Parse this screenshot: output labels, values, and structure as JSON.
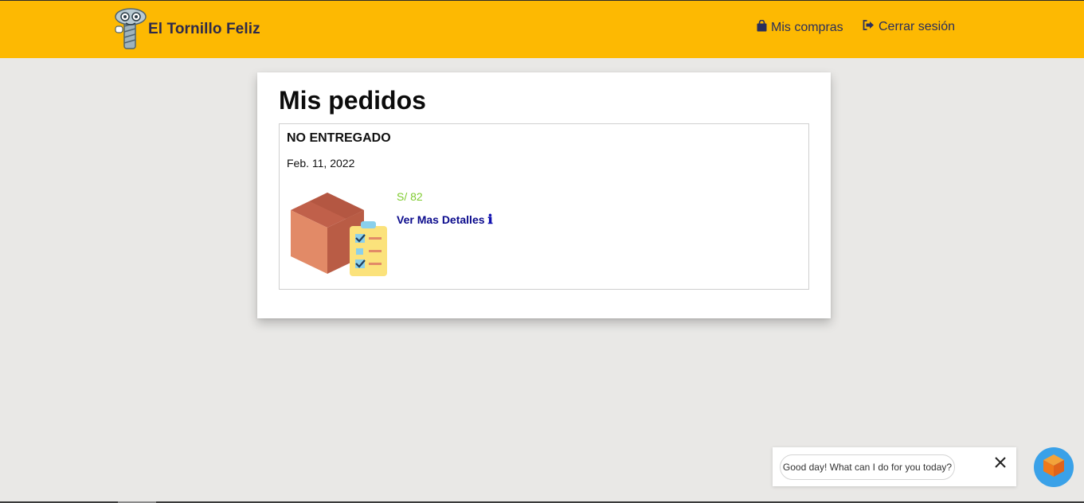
{
  "navbar": {
    "brand_name": "El Tornillo Feliz",
    "links": [
      {
        "label": "Mis compras",
        "icon": "shopping-bag-icon"
      },
      {
        "label": "Cerrar sesión",
        "icon": "sign-out-icon"
      }
    ]
  },
  "main": {
    "title": "Mis pedidos",
    "orders": [
      {
        "status": "NO ENTREGADO",
        "date": "Feb. 11, 2022",
        "price": "S/ 82",
        "details_label": "Ver Mas Detalles",
        "details_icon": "info-icon",
        "image": "package-checklist-illustration"
      }
    ]
  },
  "chat": {
    "message": "Good day! What can I do for you today?",
    "close_icon": "close-icon",
    "launcher_icon": "chat-box-icon"
  },
  "colors": {
    "navbar": "#fdb902",
    "background": "#e9e8e6",
    "price": "#7fcb2f",
    "details_link": "#0a0a8c",
    "chat_launcher": "#3aa1e8"
  }
}
